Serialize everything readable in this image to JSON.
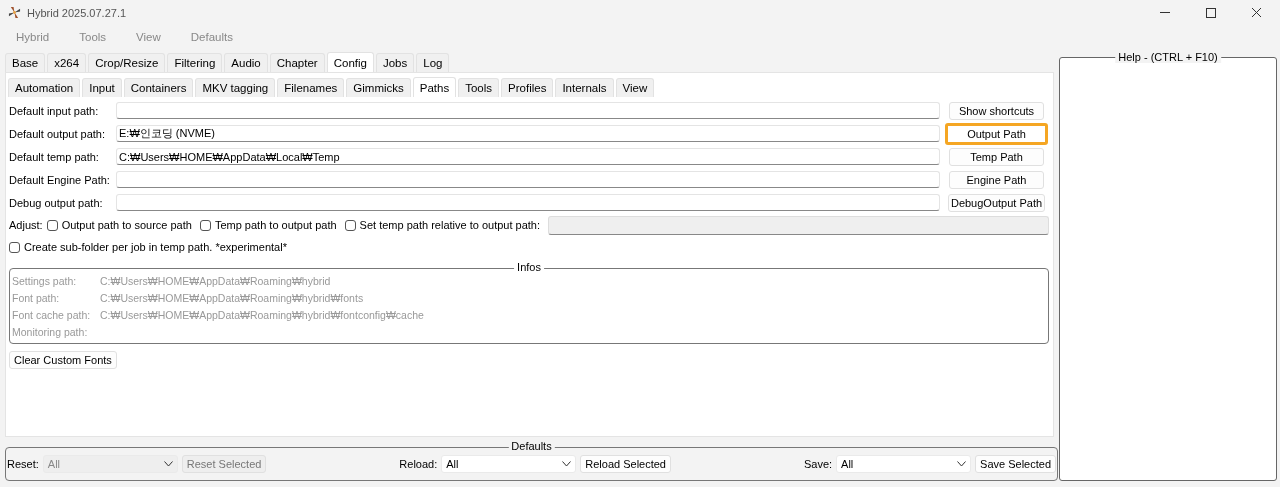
{
  "window": {
    "title": "Hybrid 2025.07.27.1"
  },
  "menu": [
    "Hybrid",
    "Tools",
    "View",
    "Defaults"
  ],
  "main_tabs": [
    {
      "label": "Base",
      "selected": false
    },
    {
      "label": "x264",
      "selected": false
    },
    {
      "label": "Crop/Resize",
      "selected": false
    },
    {
      "label": "Filtering",
      "selected": false
    },
    {
      "label": "Audio",
      "selected": false
    },
    {
      "label": "Chapter",
      "selected": false
    },
    {
      "label": "Config",
      "selected": true
    },
    {
      "label": "Jobs",
      "selected": false
    },
    {
      "label": "Log",
      "selected": false
    }
  ],
  "sub_tabs": [
    {
      "label": "Automation",
      "selected": false
    },
    {
      "label": "Input",
      "selected": false
    },
    {
      "label": "Containers",
      "selected": false
    },
    {
      "label": "MKV tagging",
      "selected": false
    },
    {
      "label": "Filenames",
      "selected": false
    },
    {
      "label": "Gimmicks",
      "selected": false
    },
    {
      "label": "Paths",
      "selected": true
    },
    {
      "label": "Tools",
      "selected": false
    },
    {
      "label": "Profiles",
      "selected": false
    },
    {
      "label": "Internals",
      "selected": false
    },
    {
      "label": "View",
      "selected": false
    }
  ],
  "path_rows": [
    {
      "label": "Default input path:",
      "value": "",
      "button": "Show shortcuts",
      "highlighted": false
    },
    {
      "label": "Default output path:",
      "value": "E:₩인코딩 (NVME)",
      "button": "Output Path",
      "highlighted": true
    },
    {
      "label": "Default temp path:",
      "value": "C:₩Users₩HOME₩AppData₩Local₩Temp",
      "button": "Temp Path",
      "highlighted": false
    },
    {
      "label": "Default Engine Path:",
      "value": "",
      "button": "Engine Path",
      "highlighted": false
    },
    {
      "label": "Debug output path:",
      "value": "",
      "button": "DebugOutput Path",
      "highlighted": false
    }
  ],
  "adjust": {
    "label": "Adjust:",
    "options": [
      {
        "label": "Output path to source path",
        "checked": false
      },
      {
        "label": "Temp path to output path",
        "checked": false
      },
      {
        "label": "Set temp path relative to output path:",
        "checked": false
      }
    ]
  },
  "subfolder_option": {
    "label": "Create sub-folder per job in temp path. *experimental*",
    "checked": false
  },
  "infos": {
    "title": "Infos",
    "rows": [
      {
        "label": "Settings path:",
        "value": "C:₩Users₩HOME₩AppData₩Roaming₩hybrid"
      },
      {
        "label": "Font path:",
        "value": "C:₩Users₩HOME₩AppData₩Roaming₩hybrid₩fonts"
      },
      {
        "label": "Font cache path:",
        "value": "C:₩Users₩HOME₩AppData₩Roaming₩hybrid₩fontconfig₩cache"
      },
      {
        "label": "Monitoring path:",
        "value": ""
      }
    ]
  },
  "clear_fonts_button": "Clear Custom Fonts",
  "defaults": {
    "title": "Defaults",
    "groups": [
      {
        "label": "Reset:",
        "value": "All",
        "button": "Reset Selected",
        "disabled": true
      },
      {
        "label": "Reload:",
        "value": "All",
        "button": "Reload Selected",
        "disabled": false
      },
      {
        "label": "Save:",
        "value": "All",
        "button": "Save Selected",
        "disabled": false
      }
    ]
  },
  "help": {
    "title": "Help - (CTRL + F10)"
  }
}
